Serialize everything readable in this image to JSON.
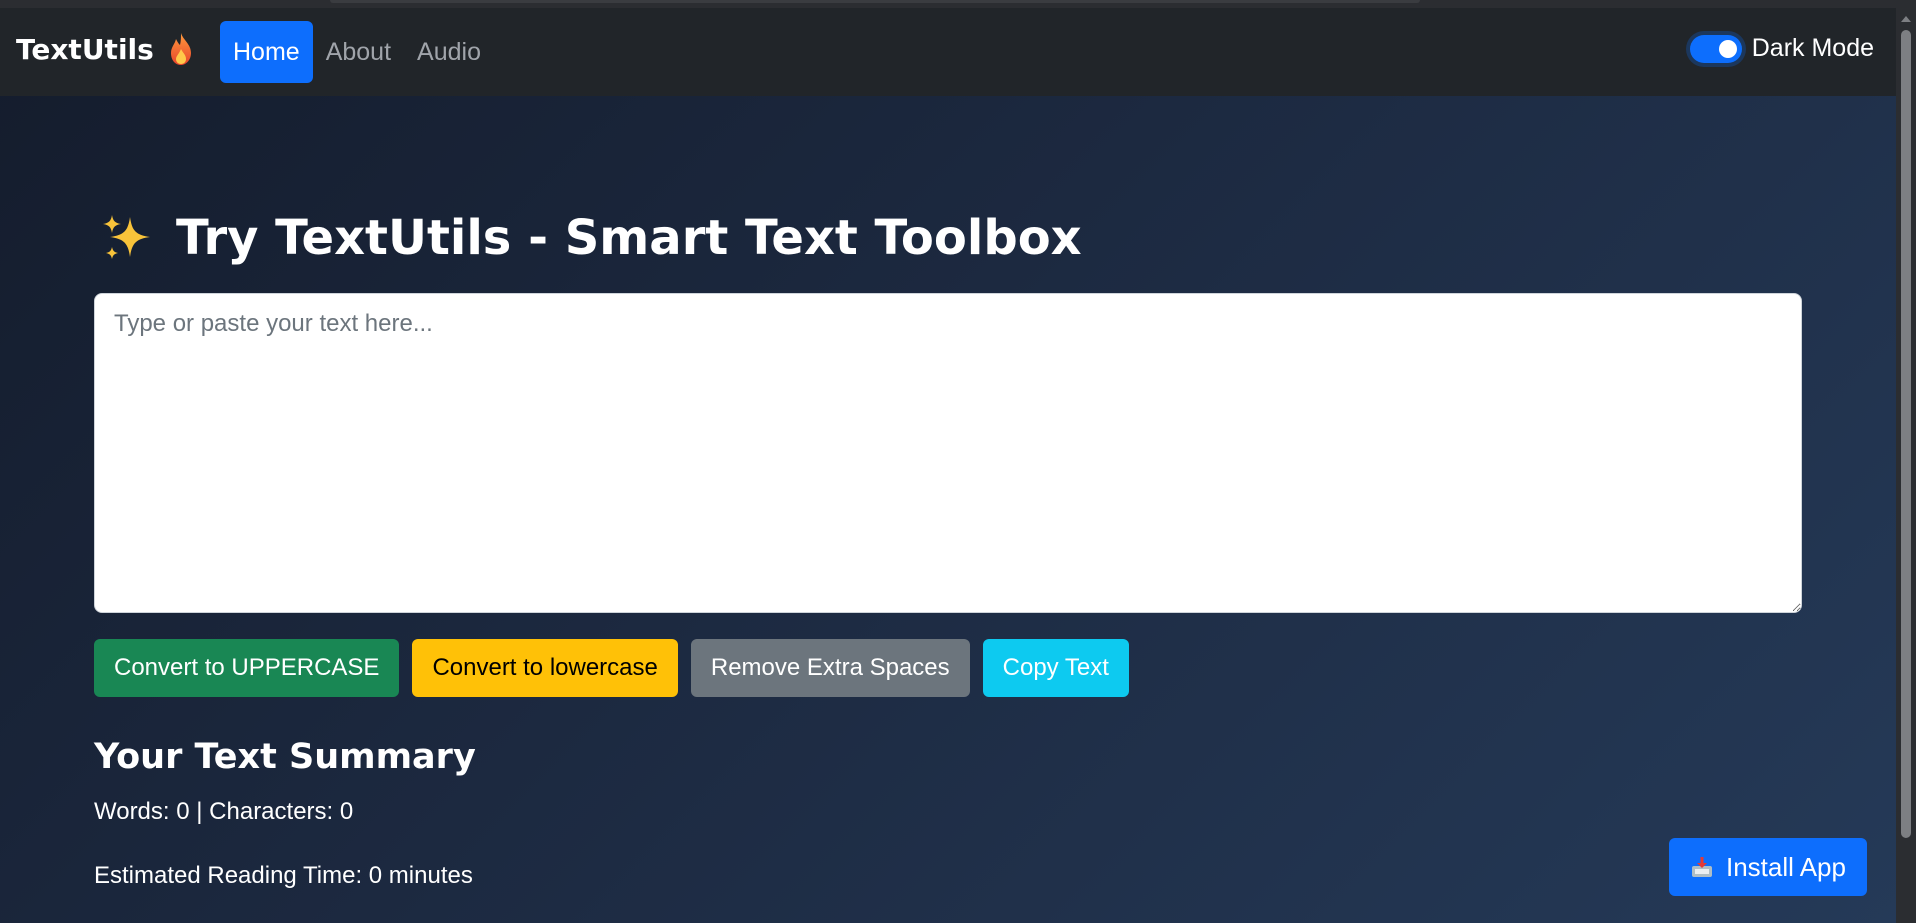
{
  "navbar": {
    "brand": "TextUtils",
    "brand_icon": "flame-icon",
    "links": [
      {
        "label": "Home",
        "active": true
      },
      {
        "label": "About",
        "active": false
      },
      {
        "label": "Audio",
        "active": false
      }
    ],
    "dark_mode_label": "Dark Mode",
    "dark_mode_on": true
  },
  "main": {
    "title": "Try TextUtils - Smart Text Toolbox",
    "title_icon": "sparkles-icon",
    "textarea": {
      "value": "",
      "placeholder": "Type or paste your text here..."
    },
    "buttons": {
      "uppercase": "Convert to UPPERCASE",
      "lowercase": "Convert to lowercase",
      "remove_spaces": "Remove Extra Spaces",
      "copy": "Copy Text"
    },
    "summary": {
      "heading": "Your Text Summary",
      "stats": "Words: 0 | Characters: 0",
      "reading_time": "Estimated Reading Time: 0 minutes"
    }
  },
  "install": {
    "label": "Install App",
    "icon": "inbox-tray-icon"
  },
  "colors": {
    "primary": "#0d6efd",
    "success": "#198754",
    "warning": "#ffc107",
    "secondary": "#6c757d",
    "info": "#0dcaf0",
    "navbar_bg": "#212529"
  }
}
